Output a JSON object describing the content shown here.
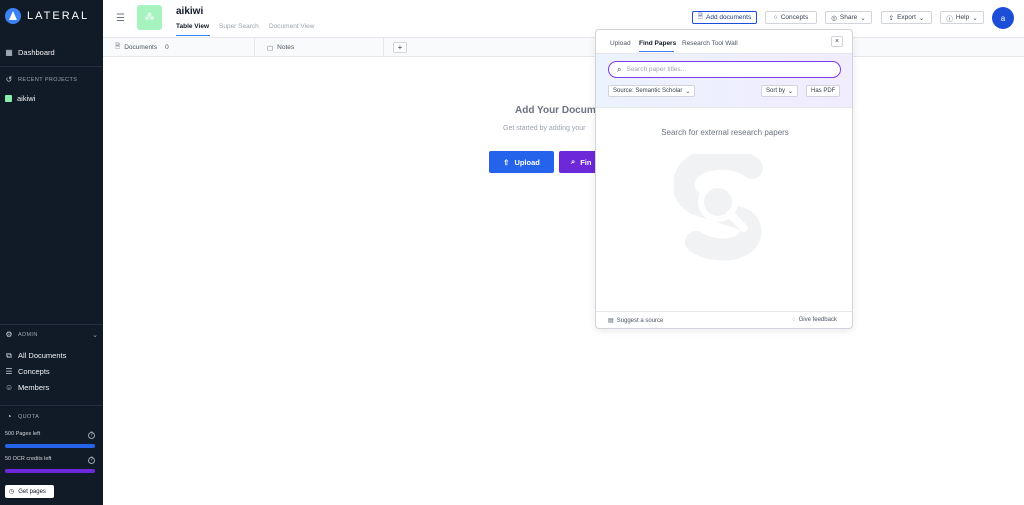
{
  "app": {
    "name": "LATERAL"
  },
  "sidebar": {
    "dashboard": "Dashboard",
    "recent_heading": "RECENT PROJECTS",
    "recent_projects": [
      "aikiwi"
    ],
    "admin_heading": "ADMIN",
    "admin_items": [
      "All Documents",
      "Concepts",
      "Members"
    ],
    "quota_heading": "QUOTA",
    "pages_left": "500 Pages left",
    "ocr_left": "50 OCR credits left",
    "pages_fraction": 1.0,
    "ocr_fraction": 1.0,
    "get_pages": "Get pages",
    "colors": {
      "pages_bar": "#2563eb",
      "ocr_bar": "#6d28d9"
    }
  },
  "header": {
    "project_title": "aikiwi",
    "tabs": [
      "Table View",
      "Super Search",
      "Document View"
    ],
    "active_tab": "Table View",
    "buttons": {
      "add_documents": "Add documents",
      "concepts": "Concepts",
      "share": "Share",
      "export": "Export",
      "help": "Help"
    },
    "avatar_initial": "a"
  },
  "table": {
    "columns": [
      {
        "label": "Documents",
        "count": "0"
      },
      {
        "label": "Notes"
      }
    ],
    "add_column": "+"
  },
  "empty_state": {
    "title": "Add Your Docume",
    "subtitle": "Get started by adding your",
    "upload_button": "Upload",
    "find_button": "Fin"
  },
  "popover": {
    "tabs": [
      "Upload",
      "Find Papers",
      "Research Tool Wall"
    ],
    "active_tab": "Find Papers",
    "close": "×",
    "search_placeholder": "Search paper titles...",
    "source_select": "Source: Semantic Scholar",
    "sort_by": "Sort by",
    "has_pdf": "Has PDF",
    "hint": "Search for external research papers",
    "suggest_source": "Suggest a source",
    "give_feedback": "Give feedback"
  }
}
